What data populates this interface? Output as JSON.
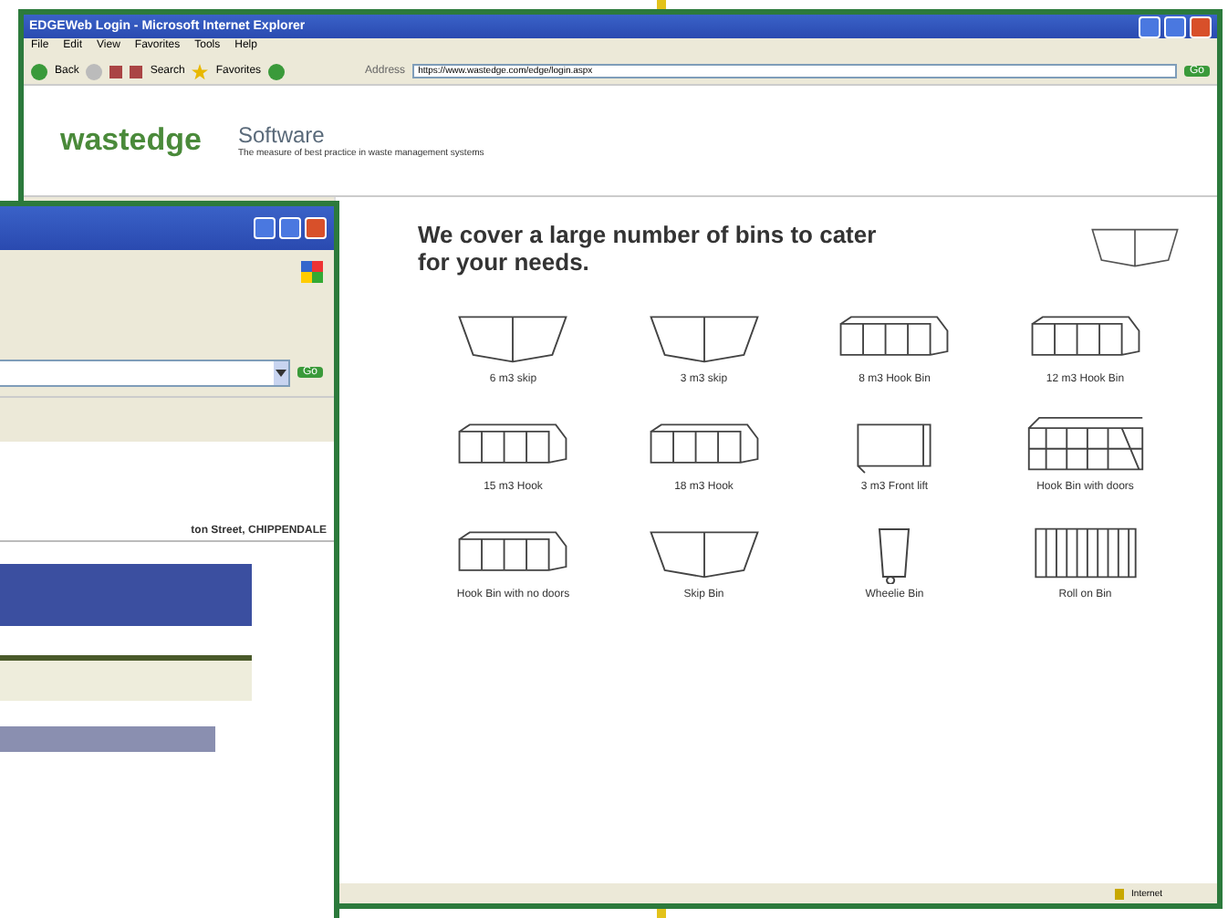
{
  "main_window": {
    "title": "EDGEWeb Login - Microsoft Internet Explorer",
    "menu": [
      "File",
      "Edit",
      "View",
      "Favorites",
      "Tools",
      "Help"
    ],
    "toolbar": [
      "Back",
      "Search",
      "Favorites"
    ],
    "address_label": "Address",
    "address": "https://www.wastedge.com/edge/login.aspx",
    "go": "Go",
    "header": {
      "logo": "wastedge",
      "product": "Software",
      "tagline": "The measure of best practice in waste management systems"
    },
    "heading": "We cover a large number of bins to cater for your needs.",
    "bins": [
      {
        "kind": "skip",
        "label": "6 m3 skip"
      },
      {
        "kind": "skip",
        "label": "3 m3 skip"
      },
      {
        "kind": "hook",
        "label": "8 m3 Hook Bin"
      },
      {
        "kind": "hook",
        "label": "12 m3 Hook Bin"
      },
      {
        "kind": "hook",
        "label": "15 m3 Hook"
      },
      {
        "kind": "hook",
        "label": "18 m3 Hook"
      },
      {
        "kind": "frontlift",
        "label": "3 m3 Front lift"
      },
      {
        "kind": "hookdoors",
        "label": "Hook Bin with doors"
      },
      {
        "kind": "hook",
        "label": "Hook Bin with no doors"
      },
      {
        "kind": "skip",
        "label": "Skip Bin"
      },
      {
        "kind": "wheelie",
        "label": "Wheelie Bin"
      },
      {
        "kind": "rollon",
        "label": "Roll on Bin"
      }
    ],
    "status": "Internet"
  },
  "second_window": {
    "go": "Go",
    "address_line": "ton Street, CHIPPENDALE"
  }
}
